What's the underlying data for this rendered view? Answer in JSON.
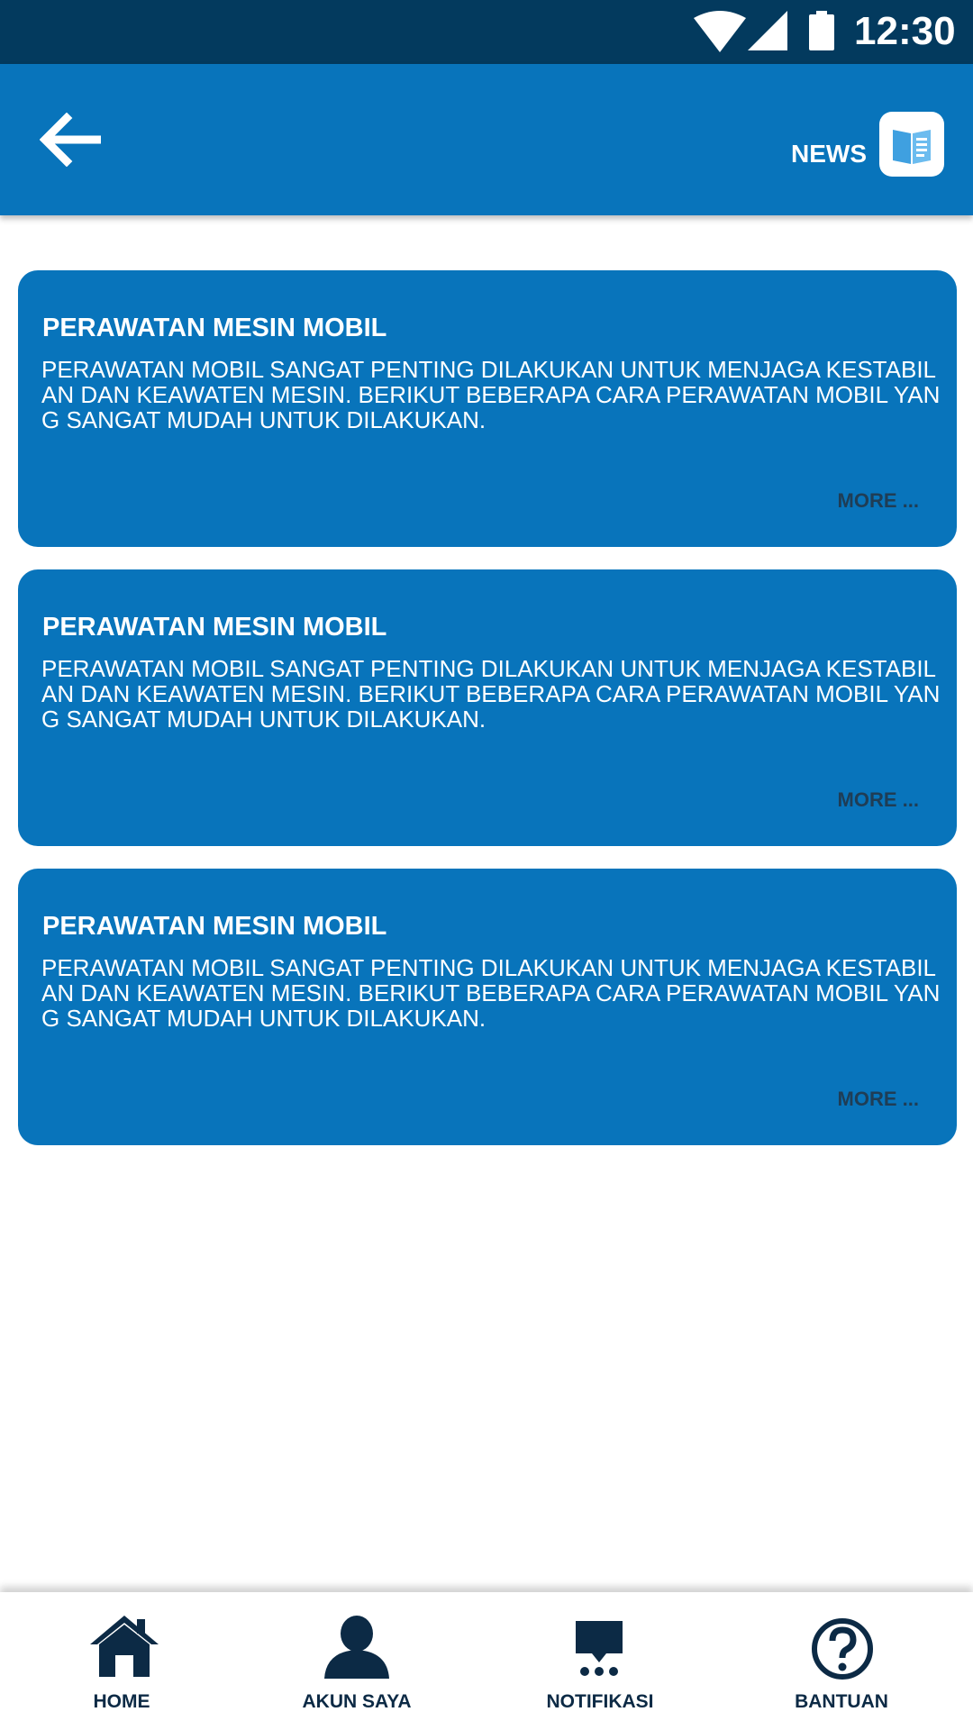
{
  "status_bar": {
    "time": "12:30"
  },
  "header": {
    "title": "NEWS"
  },
  "news": [
    {
      "title": "PERAWATAN MESIN MOBIL",
      "body": "PERAWATAN MOBIL SANGAT PENTING DILAKUKAN UNTUK MENJAGA KESTABILAN DAN KEAWATEN MESIN. BERIKUT BEBERAPA CARA PERAWATAN MOBIL YANG SANGAT MUDAH UNTUK DILAKUKAN.",
      "more": "MORE ..."
    },
    {
      "title": "PERAWATAN MESIN MOBIL",
      "body": "PERAWATAN MOBIL SANGAT PENTING DILAKUKAN UNTUK MENJAGA KESTABILAN DAN KEAWATEN MESIN. BERIKUT BEBERAPA CARA PERAWATAN MOBIL YANG SANGAT MUDAH UNTUK DILAKUKAN.",
      "more": "MORE ..."
    },
    {
      "title": "PERAWATAN MESIN MOBIL",
      "body": "PERAWATAN MOBIL SANGAT PENTING DILAKUKAN UNTUK MENJAGA KESTABILAN DAN KEAWATEN MESIN. BERIKUT BEBERAPA CARA PERAWATAN MOBIL YANG SANGAT MUDAH UNTUK DILAKUKAN.",
      "more": "MORE ..."
    }
  ],
  "bottom_nav": [
    {
      "label": "HOME",
      "icon": "home-icon"
    },
    {
      "label": "AKUN SAYA",
      "icon": "user-icon"
    },
    {
      "label": "NOTIFIKASI",
      "icon": "chat-icon"
    },
    {
      "label": "BANTUAN",
      "icon": "help-icon"
    }
  ],
  "colors": {
    "primary": "#0874bb",
    "status_bar": "#033a5e",
    "nav_icon": "#0c2a45",
    "more_text": "#1f3d55"
  }
}
